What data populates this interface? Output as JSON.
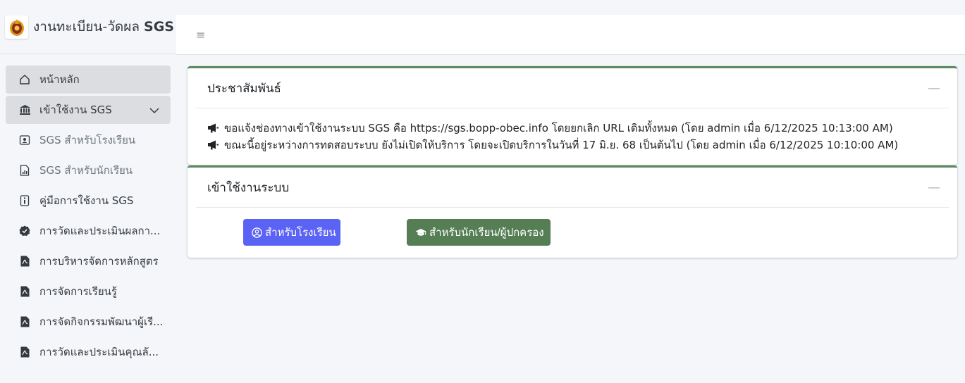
{
  "brand": {
    "title_thai": "งานทะเบียน-วัดผล",
    "title_bold": "SGS",
    "logo_icon": "school-emblem-icon"
  },
  "sidebar": {
    "items": [
      {
        "label": "หน้าหลัก",
        "icon": "home-icon"
      },
      {
        "label": "เข้าใช้งาน SGS",
        "icon": "bank-icon"
      },
      {
        "label": "SGS สำหรับโรงเรียน",
        "icon": "id-card-icon"
      },
      {
        "label": "SGS สำหรับนักเรียน",
        "icon": "file-chart-icon"
      },
      {
        "label": "คู่มือการใช้งาน SGS",
        "icon": "manual-icon"
      },
      {
        "label": "การวัดและประเมินผลกา...",
        "icon": "badge-check-icon"
      },
      {
        "label": "การบริหารจัดการหลักสูตร",
        "icon": "pdf-icon"
      },
      {
        "label": "การจัดการเรียนรู้",
        "icon": "pdf-icon"
      },
      {
        "label": "การจัดกิจกรรมพัฒนาผู้เรี...",
        "icon": "pdf-icon"
      },
      {
        "label": "การวัดและประเมินคุณลั...",
        "icon": "pdf-icon"
      }
    ]
  },
  "topbar": {
    "menu_icon": "≡"
  },
  "announcements": {
    "title": "ประชาสัมพันธ์",
    "collapse": "—",
    "lines": [
      "ขอแจ้งช่องทางเข้าใช้งานระบบ SGS คือ https://sgs.bopp-obec.info โดยยกเลิก URL เดิมทั้งหมด (โดย admin เมื่อ 6/12/2025 10:13:00 AM)",
      "ขณะนี้อยู่ระหว่างการทดสอบระบบ ยังไม่เปิดให้บริการ โดยจะเปิดบริการในวันที่ 17 มิ.ย. 68 เป็นต้นไป (โดย admin เมื่อ 6/12/2025 10:10:00 AM)"
    ]
  },
  "login": {
    "title": "เข้าใช้งานระบบ",
    "collapse": "—",
    "school_button": "สำหรับโรงเรียน",
    "student_button": "สำหรับนักเรียน/ผู้ปกครอง"
  },
  "colors": {
    "card_accent": "#5b8a5e",
    "school_button": "#5b63f4",
    "student_button": "#557e55"
  }
}
